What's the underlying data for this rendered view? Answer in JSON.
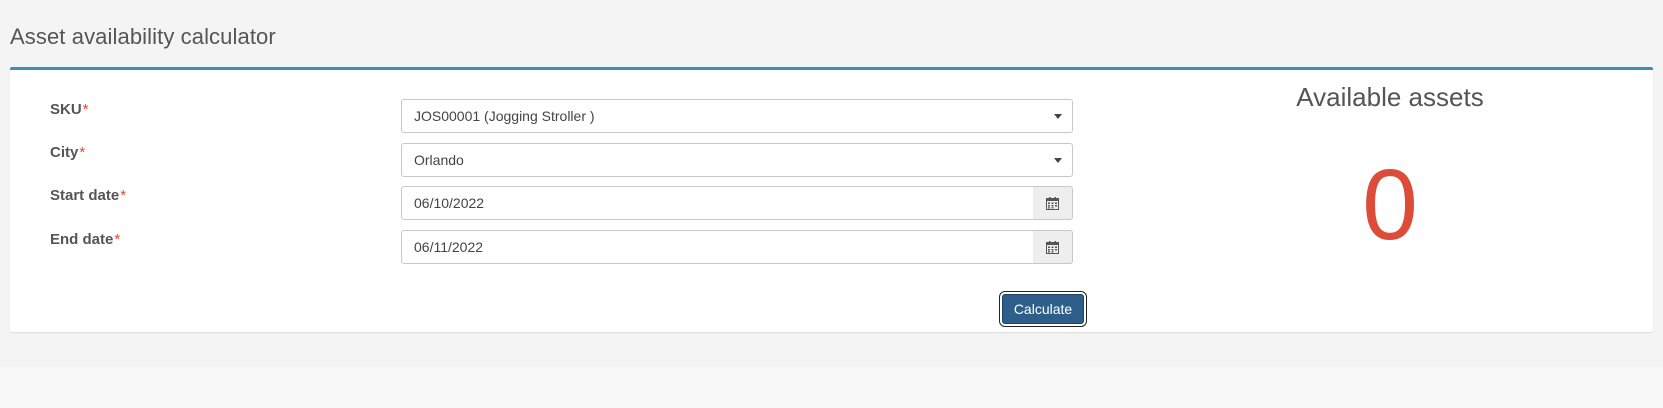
{
  "page": {
    "title": "Asset availability calculator"
  },
  "form": {
    "required_marker": "*",
    "sku": {
      "label": "SKU",
      "value": "JOS00001 (Jogging Stroller )"
    },
    "city": {
      "label": "City",
      "value": "Orlando"
    },
    "start_date": {
      "label": "Start date",
      "value": "06/10/2022"
    },
    "end_date": {
      "label": "End date",
      "value": "06/11/2022"
    },
    "calculate_label": "Calculate"
  },
  "result": {
    "title": "Available assets",
    "count": "0"
  },
  "colors": {
    "accent_border": "#3c8dbc",
    "required": "#dd4b39",
    "count": "#dd4b39",
    "button": "#2e5f8a"
  },
  "icons": {
    "dropdown": "chevron-down-icon",
    "calendar": "calendar-icon"
  }
}
